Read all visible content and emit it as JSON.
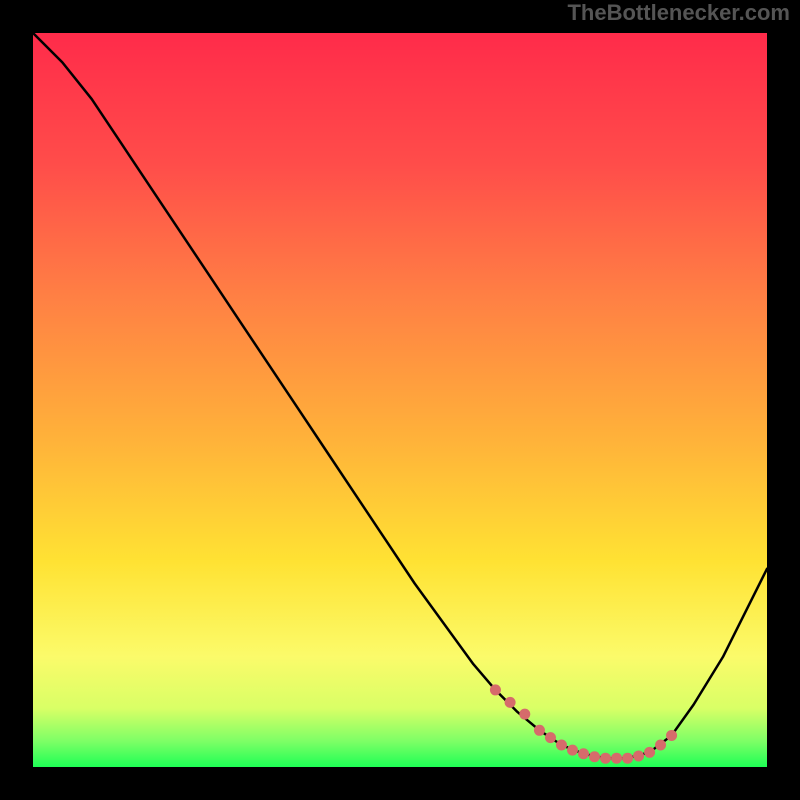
{
  "watermark": "TheBottlenecker.com",
  "colors": {
    "bg": "#000000",
    "curve": "#000000",
    "marker": "#d66b6b"
  },
  "gradient_stops": [
    {
      "offset": 0.0,
      "color": "#ff2b4a"
    },
    {
      "offset": 0.18,
      "color": "#ff4d4a"
    },
    {
      "offset": 0.36,
      "color": "#ff8044"
    },
    {
      "offset": 0.55,
      "color": "#ffb13a"
    },
    {
      "offset": 0.72,
      "color": "#ffe233"
    },
    {
      "offset": 0.85,
      "color": "#fbfb6a"
    },
    {
      "offset": 0.92,
      "color": "#d9ff66"
    },
    {
      "offset": 0.965,
      "color": "#7dff66"
    },
    {
      "offset": 1.0,
      "color": "#1eff55"
    }
  ],
  "chart_data": {
    "type": "line",
    "title": "",
    "xlabel": "",
    "ylabel": "",
    "xlim": [
      0,
      100
    ],
    "ylim": [
      0,
      100
    ],
    "grid": false,
    "series": [
      {
        "name": "curve",
        "x": [
          0,
          4,
          8,
          12,
          16,
          20,
          24,
          28,
          32,
          36,
          40,
          44,
          48,
          52,
          56,
          60,
          63,
          66,
          69,
          72,
          75,
          78,
          81,
          84,
          87,
          90,
          94,
          100
        ],
        "y": [
          100,
          96,
          91,
          85,
          79,
          73,
          67,
          61,
          55,
          49,
          43,
          37,
          31,
          25,
          19.5,
          14,
          10.5,
          7.5,
          5,
          3,
          1.8,
          1.2,
          1.2,
          2.0,
          4.3,
          8.5,
          15,
          27
        ]
      }
    ],
    "markers": {
      "x": [
        63,
        65,
        67,
        69,
        70.5,
        72,
        73.5,
        75,
        76.5,
        78,
        79.5,
        81,
        82.5,
        84,
        85.5,
        87
      ],
      "y": [
        10.5,
        8.8,
        7.2,
        5.0,
        4.0,
        3.0,
        2.3,
        1.8,
        1.4,
        1.2,
        1.2,
        1.2,
        1.5,
        2.0,
        3.0,
        4.3
      ]
    }
  }
}
